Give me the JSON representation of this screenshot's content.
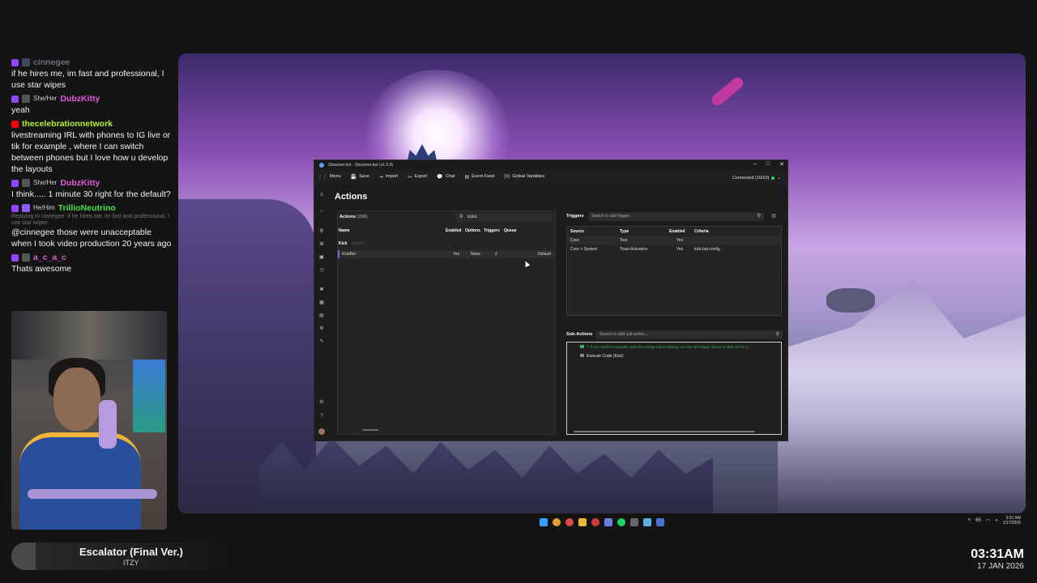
{
  "chat": [
    {
      "platform": "twitch",
      "pronouns": "",
      "username": "cinnegee",
      "color": "#6e6e7a",
      "text": "if he hires me, im fast and professional, I use star wipes"
    },
    {
      "platform": "twitch",
      "pronouns": "She/Her",
      "username": "DubzKitty",
      "color": "#e05ad6",
      "text": "yeah"
    },
    {
      "platform": "youtube",
      "pronouns": "",
      "username": "thecelebrationnetwork",
      "color": "#b8f03a",
      "text": "livestreaming IRL with phones to IG live or tik for example , where I can switch between phones but I love how u develop the layouts"
    },
    {
      "platform": "twitch",
      "pronouns": "She/Her",
      "username": "DubzKitty",
      "color": "#e05ad6",
      "text": "I think..... 1 minute 30 right for the default?"
    },
    {
      "platform": "twitch",
      "pronouns": "He/Him",
      "username": "TrillioNeutrino",
      "color": "#4be04b",
      "reply": "Replying to cinnegee: if he hires me, im fast and professional, I use star wipes",
      "text": "@cinnegee those were unacceptable when I took video production 20 years ago"
    },
    {
      "platform": "twitch",
      "pronouns": "",
      "username": "a_c_a_c",
      "color": "#e05ad6",
      "text": "Thats awesome"
    }
  ],
  "now_playing": {
    "title": "Escalator (Final Ver.)",
    "artist": "ITZY"
  },
  "clock": {
    "time": "03:31AM",
    "date": "17 JAN 2026"
  },
  "tray": {
    "temp": "65",
    "time": "3:31 AM",
    "date": "1/17/2026"
  },
  "app": {
    "window_title": "Streamer.bot - Streamer.bot (v1.0.4)",
    "window_controls": [
      "–",
      "□",
      "✕"
    ],
    "menu": [
      {
        "icon": "menu-icon",
        "glyph": "⋮⋮",
        "label": "Menu"
      },
      {
        "icon": "save-icon",
        "glyph": "💾",
        "label": "Save"
      },
      {
        "icon": "import-icon",
        "glyph": "⇥",
        "label": "Import"
      },
      {
        "icon": "export-icon",
        "glyph": "↦",
        "label": "Export"
      },
      {
        "icon": "chat-icon",
        "glyph": "💬",
        "label": "Chat"
      },
      {
        "icon": "event-feed-icon",
        "glyph": "▤",
        "label": "Event Feed"
      },
      {
        "icon": "variables-icon",
        "glyph": "(x)",
        "label": "Global Variables"
      }
    ],
    "connection": "Connected (10/10)",
    "page_title": "Actions",
    "actions": {
      "label": "Actions",
      "count": "(388)",
      "search_value": "kickb",
      "columns": [
        "Name",
        "Enabled",
        "Options",
        "Triggers",
        "Queue"
      ],
      "group": "Kick",
      "group_sub": "actions",
      "rows": [
        {
          "name": "KickBot",
          "enabled": "Yes",
          "options": "None",
          "triggers": "2",
          "queue": "Default"
        }
      ]
    },
    "triggers": {
      "label": "Triggers",
      "search_placeholder": "Search to add trigger...",
      "columns": [
        "Source",
        "Type",
        "Enabled",
        "Criteria"
      ],
      "rows": [
        {
          "source": "Core",
          "type": "Test",
          "enabled": "Yes",
          "criteria": ""
        },
        {
          "source": "Core > System",
          "type": "Toast Activation",
          "enabled": "Yes",
          "criteria": "kick.bot.config"
        }
      ]
    },
    "subactions": {
      "label": "Sub-Actions",
      "search_placeholder": "Search to add sub-action...",
      "comment": "** If you need to manually open the configuration window, use the test trigger above or click on the n",
      "items": [
        "Execute Code (Kick)"
      ]
    }
  },
  "colors": {
    "accent": "#5f7ad6",
    "connected": "#3cd15a",
    "comment": "#3fae5a"
  }
}
